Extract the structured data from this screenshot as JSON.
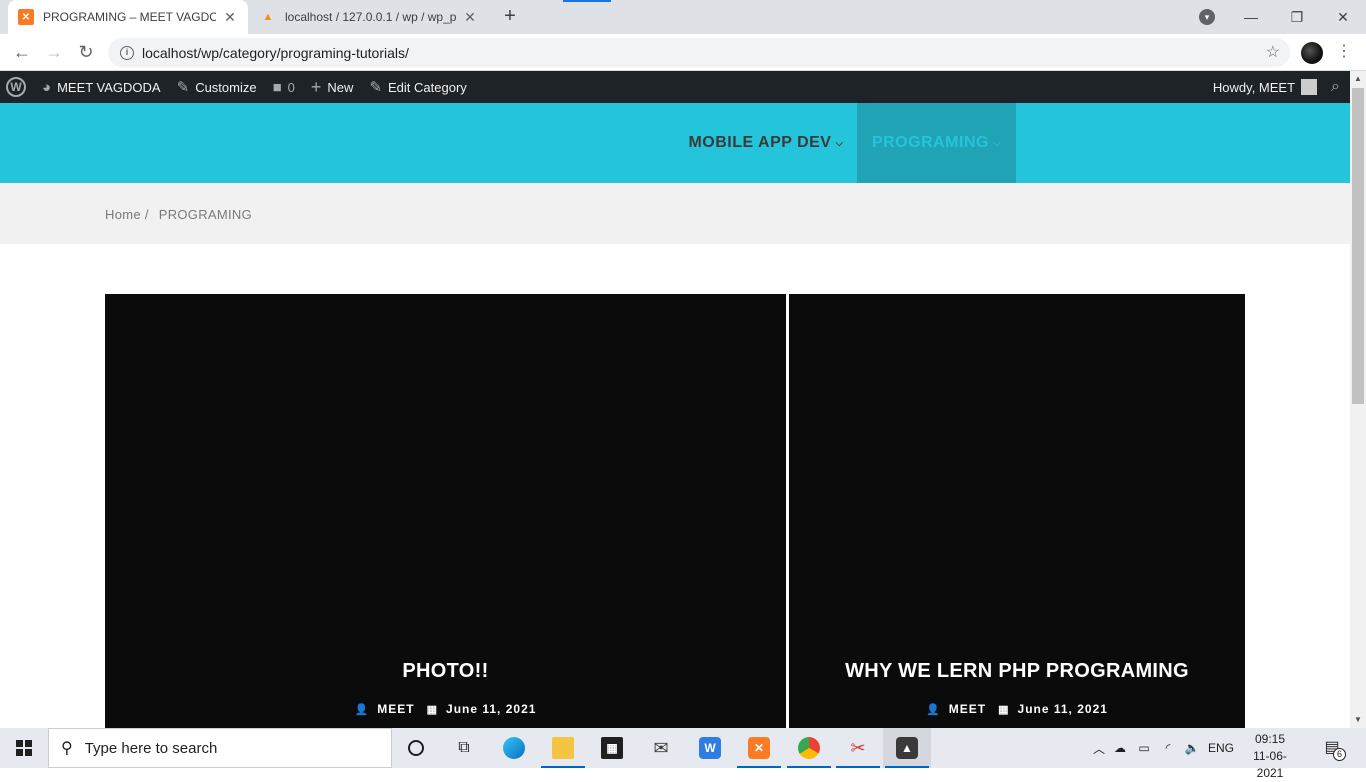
{
  "browser": {
    "tabs": [
      {
        "title": "PROGRAMING – MEET VAGDODA",
        "favicon": "xampp-icon",
        "active": true
      },
      {
        "title": "localhost / 127.0.0.1 / wp / wp_p",
        "favicon": "phpmyadmin-icon",
        "active": false
      }
    ],
    "new_tab": "+",
    "url": "localhost/wp/category/programing-tutorials/"
  },
  "adminbar": {
    "site_name": "MEET VAGDODA",
    "customize": "Customize",
    "comments_count": "0",
    "new_label": "New",
    "edit_label": "Edit Category",
    "howdy": "Howdy, MEET"
  },
  "header": {
    "menu": [
      {
        "label": "MOBILE APP DEV",
        "active": false
      },
      {
        "label": "PROGRAMING",
        "active": true
      }
    ],
    "colors": {
      "bar": "#24c5da",
      "active_bg": "#1fa3b5"
    }
  },
  "breadcrumb": {
    "home": "Home",
    "separator": "/",
    "current": "PROGRAMING"
  },
  "posts": [
    {
      "title": "PHOTO!!",
      "author": "MEET",
      "date": "June 11, 2021"
    },
    {
      "title": "WHY WE LERN PHP PROGRAMING",
      "author": "MEET",
      "date": "June 11, 2021"
    }
  ],
  "taskbar": {
    "search_placeholder": "Type here to search",
    "language": "ENG",
    "time": "09:15",
    "date": "11-06-2021",
    "notifications": "6",
    "apps": [
      "cortana-icon",
      "task-view-icon",
      "edge-icon",
      "file-explorer-icon",
      "store-icon",
      "mail-icon",
      "wps-icon",
      "xampp-icon",
      "chrome-icon",
      "snipping-icon",
      "photos-icon"
    ]
  }
}
